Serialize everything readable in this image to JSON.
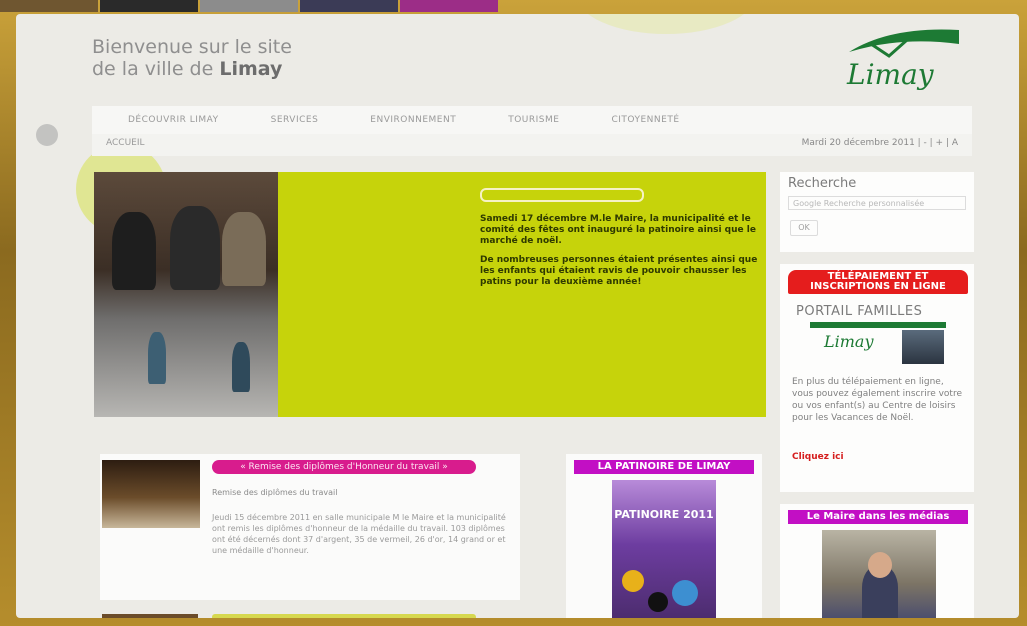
{
  "colors": {
    "accent_green": "#c6d30b",
    "red": "#e51d1d",
    "magenta": "#c20fc4",
    "pink": "#d81c8d",
    "logo_green": "#1d7a34"
  },
  "header": {
    "welcome_line1": "Bienvenue sur le site",
    "welcome_line2": "de la ville de",
    "welcome_city": "Limay",
    "logo_text": "Limay"
  },
  "nav": {
    "items": [
      "DÉCOUVRIR LIMAY",
      "SERVICES",
      "ENVIRONNEMENT",
      "TOURISME",
      "CITOYENNETÉ"
    ]
  },
  "breadcrumb": {
    "label": "ACCUEIL"
  },
  "date": {
    "text": "Mardi 20 décembre 2011  |  -  |  +  |  A"
  },
  "hero": {
    "paragraph1": "Samedi 17 décembre M.le Maire, la municipalité et le comité des fêtes ont inauguré la patinoire ainsi que le marché de noël.",
    "paragraph2": "De nombreuses personnes étaient présentes ainsi que les enfants qui étaient ravis de pouvoir chausser les patins pour la deuxième année!"
  },
  "search": {
    "title": "Recherche",
    "placeholder": "Google  Recherche personnalisée",
    "button": "OK"
  },
  "portal": {
    "heading_line1": "TÉLÉPAIEMENT ET",
    "heading_line2": "INSCRIPTIONS EN LIGNE",
    "title": "PORTAIL FAMILLES",
    "logo_text": "Limay",
    "text": "En plus du télépaiement en ligne, vous pouvez également inscrire votre ou vos enfant(s) au Centre de loisirs pour les Vacances de Noël.",
    "link": "Cliquez ici"
  },
  "news": {
    "heading": "« Remise des diplômes d'Honneur du travail »",
    "subtitle": "Remise des diplômes du travail",
    "text": "Jeudi 15 décembre 2011 en salle municipale M le Maire et la municipalité ont remis les diplômes d'honneur de la médaille du travail. 103 diplômes ont été décernés dont 37 d'argent, 35 de vermeil, 26 d'or, 14 grand or et une médaille d'honneur."
  },
  "patinoire": {
    "heading": "LA PATINOIRE DE LIMAY",
    "poster_text": "PATINOIRE 2011"
  },
  "maire": {
    "heading": "Le Maire dans les médias"
  }
}
